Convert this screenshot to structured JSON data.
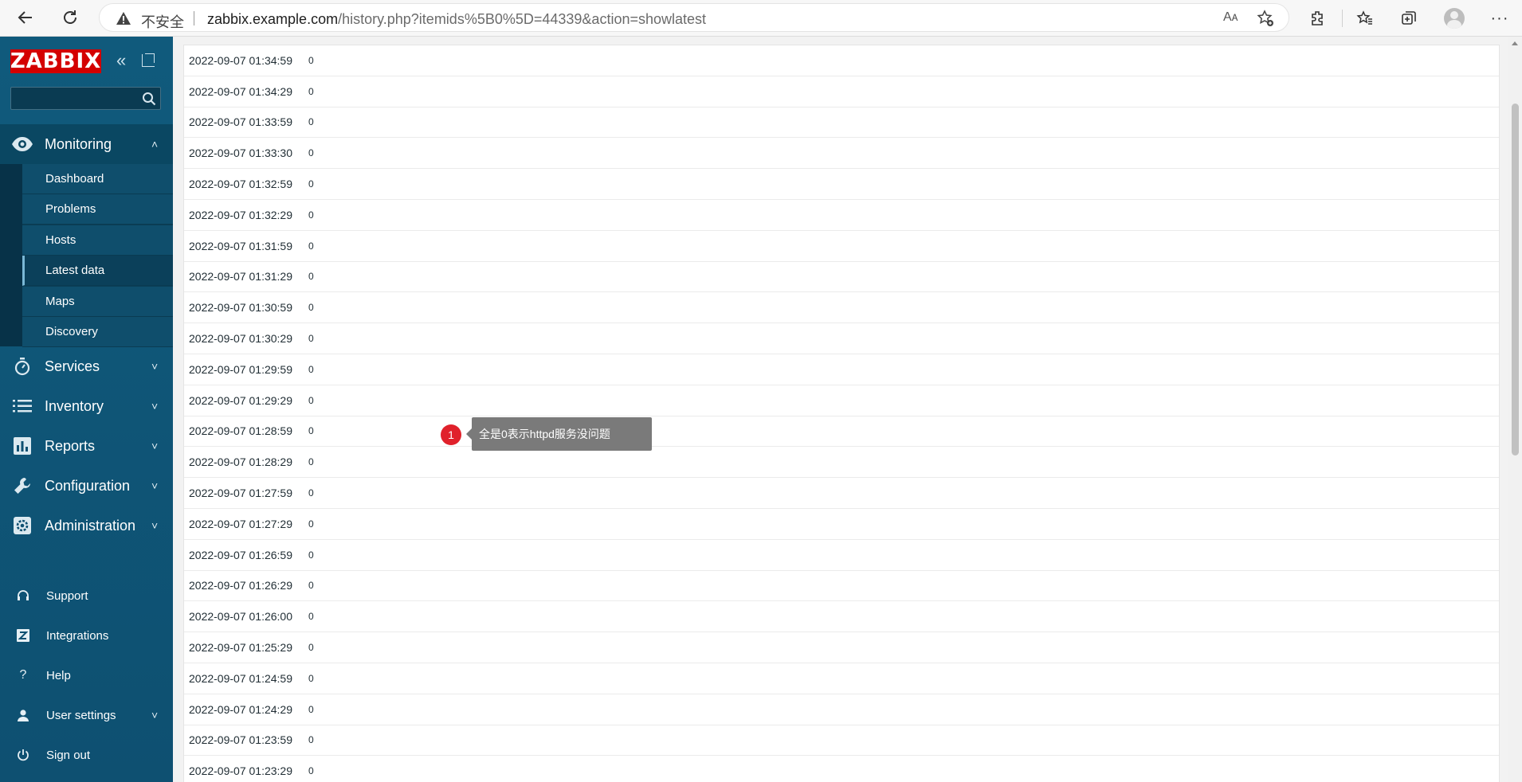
{
  "browser": {
    "security_label": "不安全",
    "url_host": "zabbix.example.com",
    "url_path": "/history.php?itemids%5B0%5D=44339&action=showlatest",
    "read_aloud_label": "Aᴀ"
  },
  "sidebar": {
    "logo": "ZABBIX",
    "search": {
      "value": "",
      "placeholder": ""
    },
    "sections": [
      {
        "label": "Monitoring",
        "icon": "eye-icon",
        "expanded": true
      },
      {
        "label": "Services",
        "icon": "stopwatch-icon"
      },
      {
        "label": "Inventory",
        "icon": "list-icon"
      },
      {
        "label": "Reports",
        "icon": "bar-chart-icon"
      },
      {
        "label": "Configuration",
        "icon": "wrench-icon"
      },
      {
        "label": "Administration",
        "icon": "gear-icon"
      }
    ],
    "monitoring_items": [
      {
        "label": "Dashboard"
      },
      {
        "label": "Problems"
      },
      {
        "label": "Hosts"
      },
      {
        "label": "Latest data",
        "selected": true
      },
      {
        "label": "Maps"
      },
      {
        "label": "Discovery"
      }
    ],
    "bottom_items": [
      {
        "label": "Support",
        "icon": "headset-icon"
      },
      {
        "label": "Integrations",
        "icon": "z-icon"
      },
      {
        "label": "Help",
        "icon": "question-icon"
      },
      {
        "label": "User settings",
        "icon": "user-icon"
      },
      {
        "label": "Sign out",
        "icon": "power-icon"
      }
    ]
  },
  "history": {
    "rows": [
      {
        "time": "2022-09-07 01:34:59",
        "value": "0"
      },
      {
        "time": "2022-09-07 01:34:29",
        "value": "0"
      },
      {
        "time": "2022-09-07 01:33:59",
        "value": "0"
      },
      {
        "time": "2022-09-07 01:33:30",
        "value": "0"
      },
      {
        "time": "2022-09-07 01:32:59",
        "value": "0"
      },
      {
        "time": "2022-09-07 01:32:29",
        "value": "0"
      },
      {
        "time": "2022-09-07 01:31:59",
        "value": "0"
      },
      {
        "time": "2022-09-07 01:31:29",
        "value": "0"
      },
      {
        "time": "2022-09-07 01:30:59",
        "value": "0"
      },
      {
        "time": "2022-09-07 01:30:29",
        "value": "0"
      },
      {
        "time": "2022-09-07 01:29:59",
        "value": "0"
      },
      {
        "time": "2022-09-07 01:29:29",
        "value": "0"
      },
      {
        "time": "2022-09-07 01:28:59",
        "value": "0"
      },
      {
        "time": "2022-09-07 01:28:29",
        "value": "0"
      },
      {
        "time": "2022-09-07 01:27:59",
        "value": "0"
      },
      {
        "time": "2022-09-07 01:27:29",
        "value": "0"
      },
      {
        "time": "2022-09-07 01:26:59",
        "value": "0"
      },
      {
        "time": "2022-09-07 01:26:29",
        "value": "0"
      },
      {
        "time": "2022-09-07 01:26:00",
        "value": "0"
      },
      {
        "time": "2022-09-07 01:25:29",
        "value": "0"
      },
      {
        "time": "2022-09-07 01:24:59",
        "value": "0"
      },
      {
        "time": "2022-09-07 01:24:29",
        "value": "0"
      },
      {
        "time": "2022-09-07 01:23:59",
        "value": "0"
      },
      {
        "time": "2022-09-07 01:23:29",
        "value": "0"
      }
    ]
  },
  "annotation": {
    "number": "1",
    "text": "全是0表示httpd服务没问题"
  },
  "colors": {
    "sidebar_bg": "#105a7c",
    "logo_bg": "#d40000",
    "annotation_badge": "#e0212b",
    "annotation_tip": "#7a7a7a"
  }
}
